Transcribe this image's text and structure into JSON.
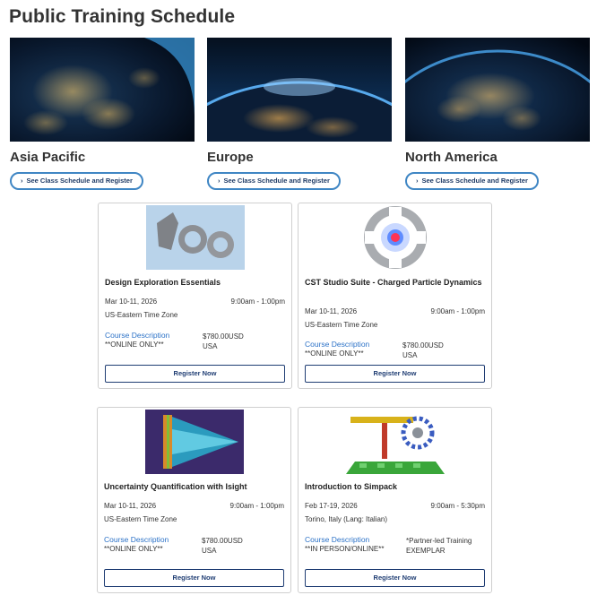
{
  "page": {
    "title": "Public Training Schedule"
  },
  "regions": [
    {
      "name": "Asia Pacific",
      "button": "See Class Schedule and Register"
    },
    {
      "name": "Europe",
      "button": "See Class Schedule and Register"
    },
    {
      "name": "North America",
      "button": "See Class Schedule and Register"
    }
  ],
  "icons": {
    "chevron": "chevron-right-icon"
  },
  "colors": {
    "accent": "#3f86c4",
    "link": "#2c72c7",
    "button_border": "#1f3d73"
  },
  "courses": [
    {
      "title": "Design Exploration Essentials",
      "date": "Mar 10-11, 2026",
      "time": "9:00am - 1:00pm",
      "location": "US-Eastern Time Zone",
      "desc_link": "Course Description",
      "mode": "**ONLINE ONLY**",
      "price": "$780.00USD",
      "price_sub": "USA",
      "register": "Register Now"
    },
    {
      "title": "CST Studio Suite - Charged Particle Dynamics",
      "date": "Mar 10-11, 2026",
      "time": "9:00am - 1:00pm",
      "location": "US-Eastern Time Zone",
      "desc_link": "Course Description",
      "mode": "**ONLINE ONLY**",
      "price": "$780.00USD",
      "price_sub": "USA",
      "register": "Register Now"
    },
    {
      "title": "Uncertainty Quantification with Isight",
      "date": "Mar 10-11, 2026",
      "time": "9:00am - 1:00pm",
      "location": "US-Eastern Time Zone",
      "desc_link": "Course Description",
      "mode": "**ONLINE ONLY**",
      "price": "$780.00USD",
      "price_sub": "USA",
      "register": "Register Now"
    },
    {
      "title": "Introduction to Simpack",
      "date": "Feb 17-19, 2026",
      "time": "9:00am - 5:30pm",
      "location": "Torino, Italy (Lang: Italian)",
      "desc_link": "Course Description",
      "mode": "**IN PERSON/ONLINE**",
      "price": "*Partner-led Training",
      "price_sub": "EXEMPLAR",
      "register": "Register Now"
    }
  ]
}
